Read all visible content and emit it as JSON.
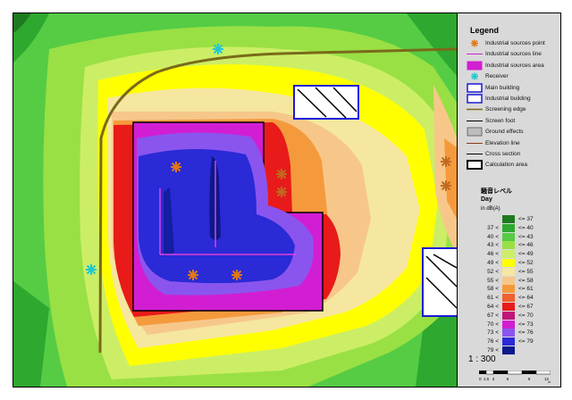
{
  "legend": {
    "title": "Legend",
    "items": [
      {
        "label": "Industrial sources point",
        "icon": "asterisk-orange-icon"
      },
      {
        "label": "Industrial sources line",
        "icon": "magenta-line-icon"
      },
      {
        "label": "Industrial sources area",
        "icon": "magenta-square-icon"
      },
      {
        "label": "Receiver",
        "icon": "asterisk-cyan-icon"
      },
      {
        "label": "Main building",
        "icon": "blue-outline-box-icon"
      },
      {
        "label": "Industrial building",
        "icon": "blue-outline-box-icon"
      },
      {
        "label": "Screening edge",
        "icon": "olive-line-icon"
      },
      {
        "label": "Screen foot",
        "icon": "black-line-icon"
      },
      {
        "label": "Ground effects",
        "icon": "grey-box-icon"
      },
      {
        "label": "Elevation line",
        "icon": "brown-line-icon"
      },
      {
        "label": "Cross section",
        "icon": "black-line-icon"
      },
      {
        "label": "Calculation area",
        "icon": "black-thick-box-icon"
      }
    ]
  },
  "noise_scale": {
    "title_line1": "騒音レベル",
    "title_line2": "Day",
    "unit": "in dB(A)",
    "bands": [
      {
        "lo": "",
        "hi": "<= 37",
        "color": "#1f7a1f"
      },
      {
        "lo": "37 <",
        "hi": "<= 40",
        "color": "#2ea82e"
      },
      {
        "lo": "40 <",
        "hi": "<= 43",
        "color": "#55cc44"
      },
      {
        "lo": "43 <",
        "hi": "<= 46",
        "color": "#99e044"
      },
      {
        "lo": "46 <",
        "hi": "<= 49",
        "color": "#ccee66"
      },
      {
        "lo": "49 <",
        "hi": "<= 52",
        "color": "#ffff00"
      },
      {
        "lo": "52 <",
        "hi": "<= 55",
        "color": "#f5e6a0"
      },
      {
        "lo": "55 <",
        "hi": "<= 58",
        "color": "#f7c78a"
      },
      {
        "lo": "58 <",
        "hi": "<= 61",
        "color": "#f59a3c"
      },
      {
        "lo": "61 <",
        "hi": "<= 64",
        "color": "#f06030"
      },
      {
        "lo": "64 <",
        "hi": "<= 67",
        "color": "#e81a1a"
      },
      {
        "lo": "67 <",
        "hi": "<= 70",
        "color": "#c0147a"
      },
      {
        "lo": "70 <",
        "hi": "<= 73",
        "color": "#d21ed2"
      },
      {
        "lo": "73 <",
        "hi": "<= 76",
        "color": "#8a55ee"
      },
      {
        "lo": "76 <",
        "hi": "<= 79",
        "color": "#2a2ad6"
      },
      {
        "lo": "79 <",
        "hi": "",
        "color": "#0a1a8a"
      }
    ]
  },
  "scale": {
    "label": "1 : 300",
    "ticks": [
      "0",
      "1.5",
      "3",
      "6",
      "9",
      "12"
    ],
    "unit": "m"
  }
}
